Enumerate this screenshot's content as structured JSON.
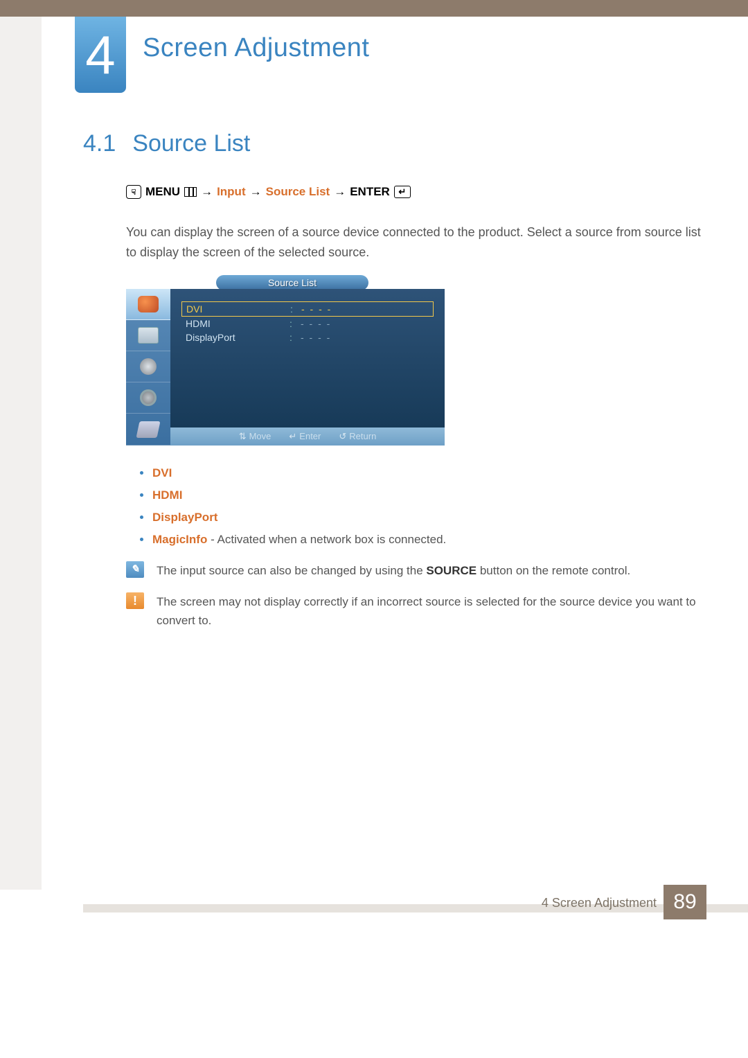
{
  "chapter": {
    "number": "4",
    "title": "Screen Adjustment"
  },
  "section": {
    "number": "4.1",
    "title": "Source List"
  },
  "navpath": {
    "menu": "MENU",
    "input": "Input",
    "sourcelist": "Source List",
    "enter": "ENTER",
    "arrow": "→"
  },
  "intro": "You can display the screen of a source device connected to the product. Select a source from source list to display the screen of the selected source.",
  "osd": {
    "title": "Source List",
    "rows": [
      {
        "label": "DVI",
        "value": "- - - -",
        "selected": true
      },
      {
        "label": "HDMI",
        "value": "- - - -",
        "selected": false
      },
      {
        "label": "DisplayPort",
        "value": "- - - -",
        "selected": false
      }
    ],
    "footer": {
      "move": "Move",
      "enter": "Enter",
      "return": "Return"
    }
  },
  "bullets": [
    {
      "label": "DVI",
      "rest": ""
    },
    {
      "label": "HDMI",
      "rest": ""
    },
    {
      "label": "DisplayPort",
      "rest": ""
    },
    {
      "label": "MagicInfo",
      "rest": " - Activated when a network box is connected."
    }
  ],
  "note_pencil_pre": "The input source can also be changed by using the ",
  "note_pencil_bold": "SOURCE",
  "note_pencil_post": " button on the remote control.",
  "note_warn": "The screen may not display correctly if an incorrect source is selected for the source device you want to convert to.",
  "footer": {
    "label": "4 Screen Adjustment",
    "page": "89"
  }
}
